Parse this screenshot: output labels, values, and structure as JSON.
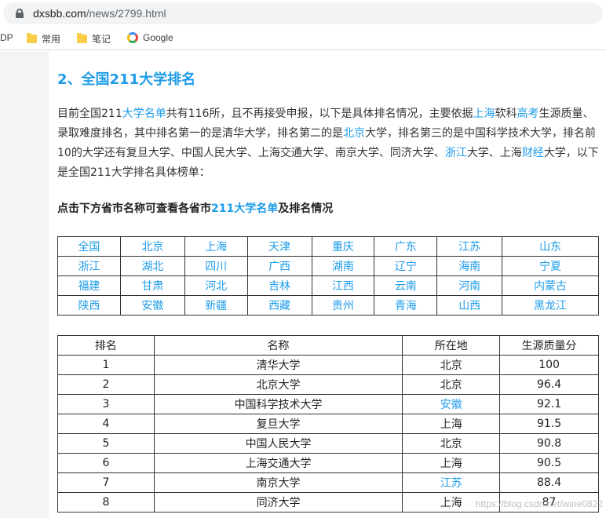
{
  "browser": {
    "url_domain": "dxsbb.com",
    "url_path": "/news/2799.html",
    "bookmarks": [
      "DP",
      "常用",
      "笔记",
      "Google"
    ]
  },
  "article": {
    "heading": "2、全国211大学排名",
    "para_parts": [
      {
        "t": "目前全国211",
        "link": false
      },
      {
        "t": "大学名单",
        "link": true
      },
      {
        "t": "共有116所，且不再接受申报，以下是具体排名情况，主要依据",
        "link": false
      },
      {
        "t": "上海",
        "link": true
      },
      {
        "t": "软科",
        "link": false
      },
      {
        "t": "高考",
        "link": true
      },
      {
        "t": "生源质量、录取难度排名，其中排名第一的是清华大学，排名第二的是",
        "link": false
      },
      {
        "t": "北京",
        "link": true
      },
      {
        "t": "大学，排名第三的是中国科学技术大学，排名前10的大学还有复旦大学、中国人民大学、上海交通大学、南京大学、同济大学、",
        "link": false
      },
      {
        "t": "浙江",
        "link": true
      },
      {
        "t": "大学、上海",
        "link": false
      },
      {
        "t": "财经",
        "link": true
      },
      {
        "t": "大学，以下是全国211大学排名具体榜单：",
        "link": false
      }
    ],
    "sub_prefix": "点击下方省市名称可查看各省市",
    "sub_link": "211大学名单",
    "sub_suffix": "及排名情况"
  },
  "provinces": [
    [
      "全国",
      "北京",
      "上海",
      "天津",
      "重庆",
      "广东",
      "江苏",
      "山东"
    ],
    [
      "浙江",
      "湖北",
      "四川",
      "广西",
      "湖南",
      "辽宁",
      "海南",
      "宁夏"
    ],
    [
      "福建",
      "甘肃",
      "河北",
      "吉林",
      "江西",
      "云南",
      "河南",
      "内蒙古"
    ],
    [
      "陕西",
      "安徽",
      "新疆",
      "西藏",
      "贵州",
      "青海",
      "山西",
      "黑龙江"
    ]
  ],
  "ranking": {
    "headers": [
      "排名",
      "名称",
      "所在地",
      "生源质量分"
    ],
    "rows": [
      {
        "rank": "1",
        "name": "清华大学",
        "loc": "北京",
        "loc_link": false,
        "score": "100"
      },
      {
        "rank": "2",
        "name": "北京大学",
        "loc": "北京",
        "loc_link": false,
        "score": "96.4"
      },
      {
        "rank": "3",
        "name": "中国科学技术大学",
        "loc": "安徽",
        "loc_link": true,
        "score": "92.1"
      },
      {
        "rank": "4",
        "name": "复旦大学",
        "loc": "上海",
        "loc_link": false,
        "score": "91.5"
      },
      {
        "rank": "5",
        "name": "中国人民大学",
        "loc": "北京",
        "loc_link": false,
        "score": "90.8"
      },
      {
        "rank": "6",
        "name": "上海交通大学",
        "loc": "上海",
        "loc_link": false,
        "score": "90.5"
      },
      {
        "rank": "7",
        "name": "南京大学",
        "loc": "江苏",
        "loc_link": true,
        "score": "88.4"
      },
      {
        "rank": "8",
        "name": "同济大学",
        "loc": "上海",
        "loc_link": false,
        "score": "87"
      }
    ]
  },
  "watermark": "https://blog.csdn.net/wine0822"
}
